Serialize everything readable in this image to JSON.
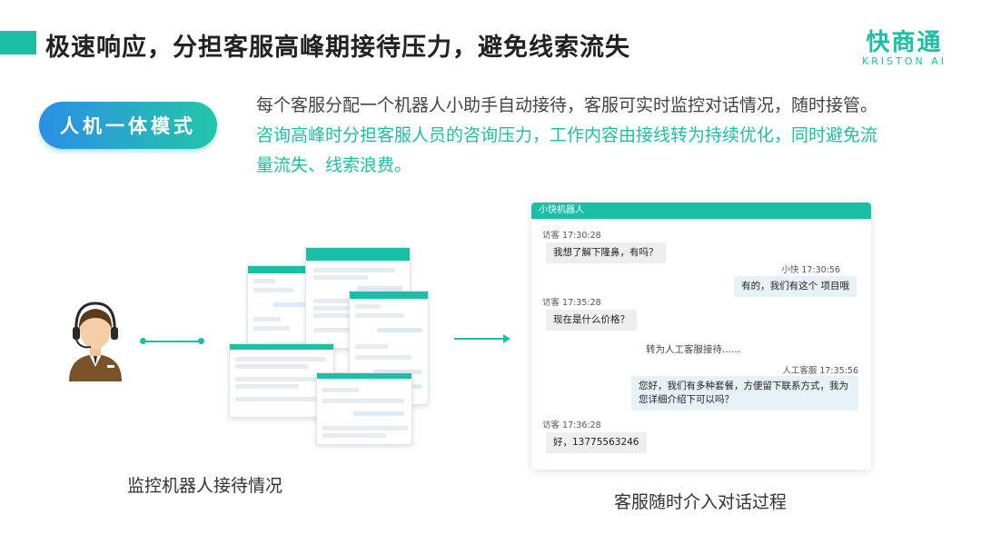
{
  "header": {
    "title": "极速响应，分担客服高峰期接待压力，避免线索流失"
  },
  "logo": {
    "cn": "快商通",
    "en": "KRISTON AI"
  },
  "mode": {
    "label": "人机一体模式"
  },
  "description": {
    "normal": "每个客服分配一个机器人小助手自动接待，客服可实时监控对话情况，随时接管。",
    "highlight": "咨询高峰时分担客服人员的咨询压力，工作内容由接线转为持续优化，同时避免流量流失、线索浪费。"
  },
  "captions": {
    "left": "监控机器人接待情况",
    "right": "客服随时介入对话过程"
  },
  "chat": {
    "title": "小快机器人",
    "messages": [
      {
        "meta": "访客 17:30:28",
        "text": "我想了解下隆鼻，有吗？"
      },
      {
        "meta": "小快 17:30:56",
        "text": "有的，我们有这个 项目哦"
      },
      {
        "meta": "访客 17:35:28",
        "text": "现在是什么价格？"
      },
      {
        "system": "转为人工客服接待......"
      },
      {
        "meta": "人工客服 17:35:56",
        "text": "您好，我们有多种套餐，方便留下联系方式，我为您详细介绍下可以吗？"
      },
      {
        "meta": "访客 17:36:28",
        "text": "好，13775563246"
      }
    ]
  },
  "colors": {
    "accent": "#1cbfa5",
    "pill_start": "#2b8fe6",
    "pill_end": "#22c6a8"
  }
}
